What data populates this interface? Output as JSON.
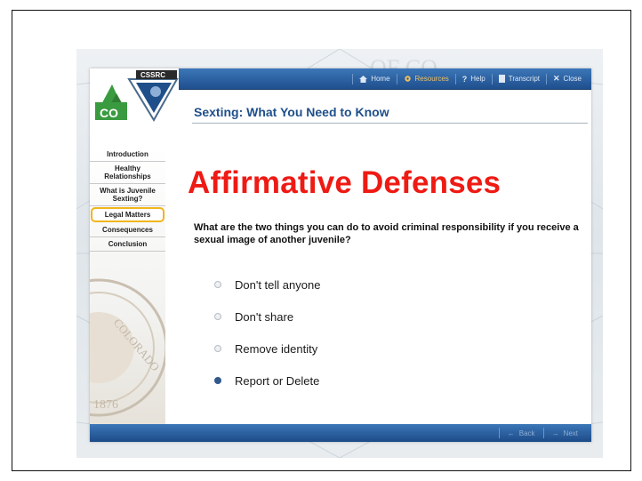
{
  "course": {
    "title": "Sexting: What You Need to Know",
    "logo": {
      "text_top": "CSSRC",
      "text_main": "CO"
    }
  },
  "top_nav": [
    {
      "label": "Home",
      "icon": "home-icon"
    },
    {
      "label": "Resources",
      "icon": "gear-icon",
      "active": true
    },
    {
      "label": "Help",
      "icon": "help-icon"
    },
    {
      "label": "Transcript",
      "icon": "document-icon"
    },
    {
      "label": "Close",
      "icon": "close-icon"
    }
  ],
  "sidebar": {
    "items": [
      {
        "label": "Introduction"
      },
      {
        "label": "Healthy Relationships"
      },
      {
        "label": "What is Juvenile Sexting?"
      },
      {
        "label": "Legal Matters",
        "selected": true
      },
      {
        "label": "Consequences"
      },
      {
        "label": "Conclusion"
      }
    ],
    "seal_text": [
      "COLORADO",
      "1876"
    ]
  },
  "content": {
    "heading": "Affirmative Defenses",
    "question": "What are the two things you can do to avoid criminal responsibility if you receive a sexual image of another juvenile?",
    "options": [
      {
        "label": "Don't tell anyone",
        "checked": false
      },
      {
        "label": "Don't share",
        "checked": false
      },
      {
        "label": "Remove identity",
        "checked": false
      },
      {
        "label": "Report or Delete",
        "checked": true
      }
    ]
  },
  "bottom_nav": {
    "back": "Back",
    "next": "Next"
  },
  "colors": {
    "brand_blue": "#1e4f8a",
    "heading_red": "#ee1a14",
    "selected_border": "#f1b51c",
    "logo_green": "#3a9a3f"
  }
}
